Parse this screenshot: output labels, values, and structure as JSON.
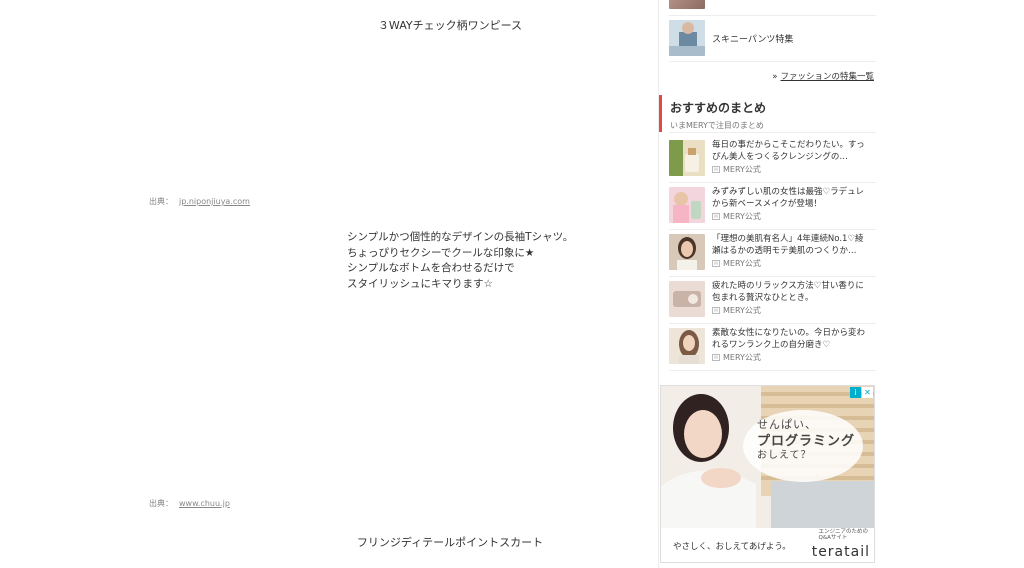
{
  "main": {
    "item1_title": "３WAYチェック柄ワンピース",
    "source1_label": "出典：",
    "source1_link": "jp.niponjiuya.com",
    "description": [
      "シンプルかつ個性的なデザインの長袖Tシャツ。",
      "ちょっぴりセクシーでクールな印象に★",
      "シンプルなボトムを合わせるだけで",
      "スタイリッシュにキマります☆"
    ],
    "source2_label": "出典：",
    "source2_link": "www.chuu.jp",
    "item2_title": "フリンジディテールポイントスカート"
  },
  "sidebar": {
    "feature_label": "スキニーパンツ特集",
    "all_features_link": "ファッションの特集一覧",
    "all_features_bullet": "»",
    "section_title": "おすすめのまとめ",
    "section_subtitle": "いまMERYで注目のまとめ",
    "articles": [
      {
        "title": "毎日の事だからこそこだわりたい。すっぴん美人をつくるクレンジングの…",
        "source": "MERY公式"
      },
      {
        "title": "みずみずしい肌の女性は最強♡ラデュレから新ベースメイクが登場！",
        "source": "MERY公式"
      },
      {
        "title": "「理想の美肌有名人」4年連続No.1♡綾瀬はるかの透明モテ美肌のつくりか…",
        "source": "MERY公式"
      },
      {
        "title": "疲れた時のリラックス方法♡甘い香りに包まれる贅沢なひととき。",
        "source": "MERY公式"
      },
      {
        "title": "素敵な女性になりたいの。今日から変われるワンランク上の自分磨き♡",
        "source": "MERY公式"
      }
    ]
  },
  "ad": {
    "line1": "せんぱい、",
    "line2": "プログラミング",
    "line3": "おしえて？",
    "tagline": "やさしく、おしえてあげよう。",
    "brand_sub_1": "エンジニアのための",
    "brand_sub_2": "Q&Aサイト",
    "brand": "teratail"
  },
  "colors": {
    "accent": "#e24a4a",
    "ad_badge": "#00aecd"
  }
}
